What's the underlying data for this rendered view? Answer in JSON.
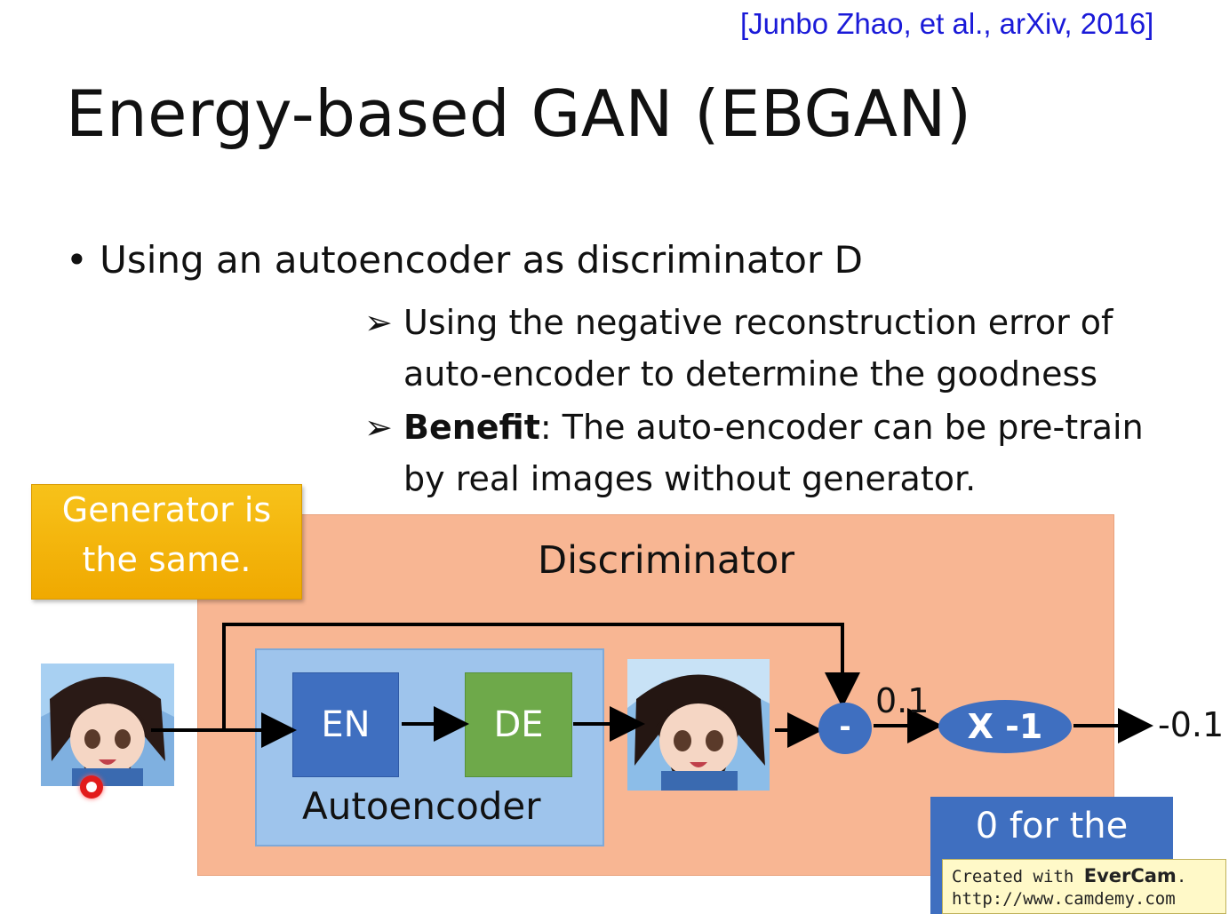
{
  "citation": "[Junbo Zhao, et al., arXiv, 2016]",
  "title": "Energy-based GAN (EBGAN)",
  "bullet": "Using an autoencoder as discriminator D",
  "subpoints": [
    {
      "line1": "Using the negative reconstruction error of",
      "line2": "auto-encoder to determine the goodness"
    },
    {
      "bold": "Benefit",
      "line1_rest": ": The auto-encoder can be pre-train",
      "line2": "by real images without generator."
    }
  ],
  "diagram": {
    "generator_note_line1": "Generator is",
    "generator_note_line2": "the same.",
    "discriminator_label": "Discriminator",
    "encoder_label": "EN",
    "decoder_label": "DE",
    "autoencoder_label": "Autoencoder",
    "subtract_symbol": "-",
    "diff_value": "0.1",
    "multiply_label": "X -1",
    "output_value": "-0.1",
    "partial_box_text": "0 for the"
  },
  "watermark": {
    "prefix": "Created with ",
    "brand": "EverCam",
    "suffix": ".",
    "url": "http://www.camdemy.com"
  },
  "colors": {
    "citation": "#1a1ad8",
    "generator_box": "#f0a900",
    "discriminator_box": "#f8b693",
    "autoencoder_box": "#9ec4ec",
    "encoder": "#3f6fc0",
    "decoder": "#6ea94a",
    "operator_nodes": "#3f6fc0"
  }
}
